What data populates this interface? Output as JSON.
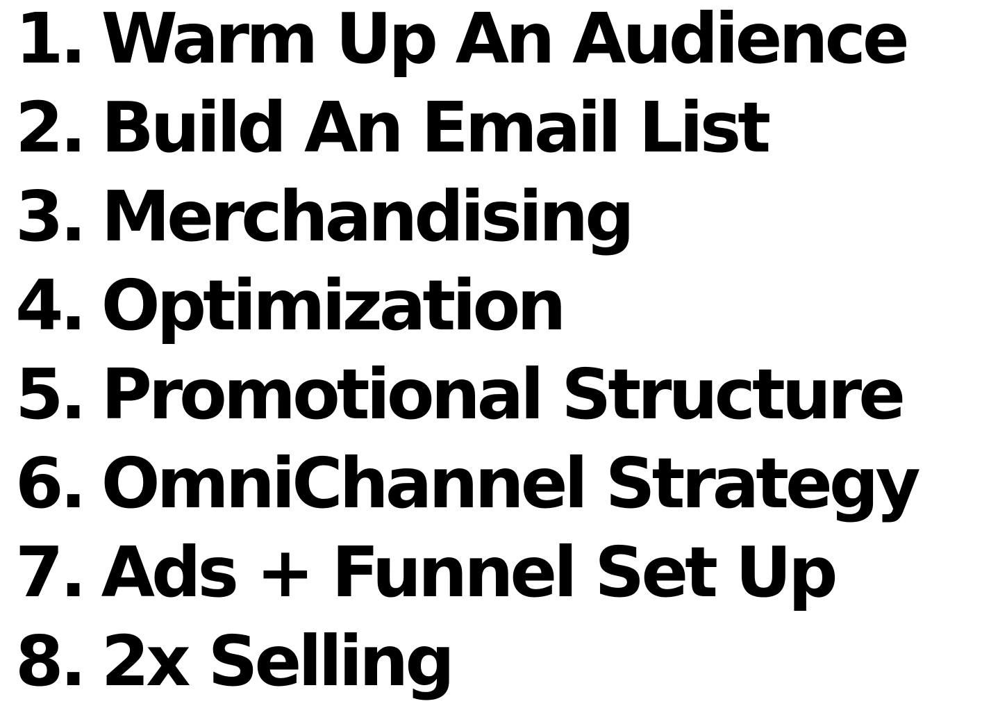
{
  "items": [
    {
      "number": "1.",
      "label": "Warm Up An Audience"
    },
    {
      "number": "2.",
      "label": "Build An Email List"
    },
    {
      "number": "3.",
      "label": "Merchandising"
    },
    {
      "number": "4.",
      "label": "Optimization"
    },
    {
      "number": "5.",
      "label": "Promotional Structure"
    },
    {
      "number": "6.",
      "label": "OmniChannel Strategy"
    },
    {
      "number": "7.",
      "label": "Ads + Funnel Set Up"
    },
    {
      "number": "8.",
      "label": "2x Selling"
    }
  ],
  "colors": {
    "text": "#000000",
    "background": "#ffffff"
  }
}
